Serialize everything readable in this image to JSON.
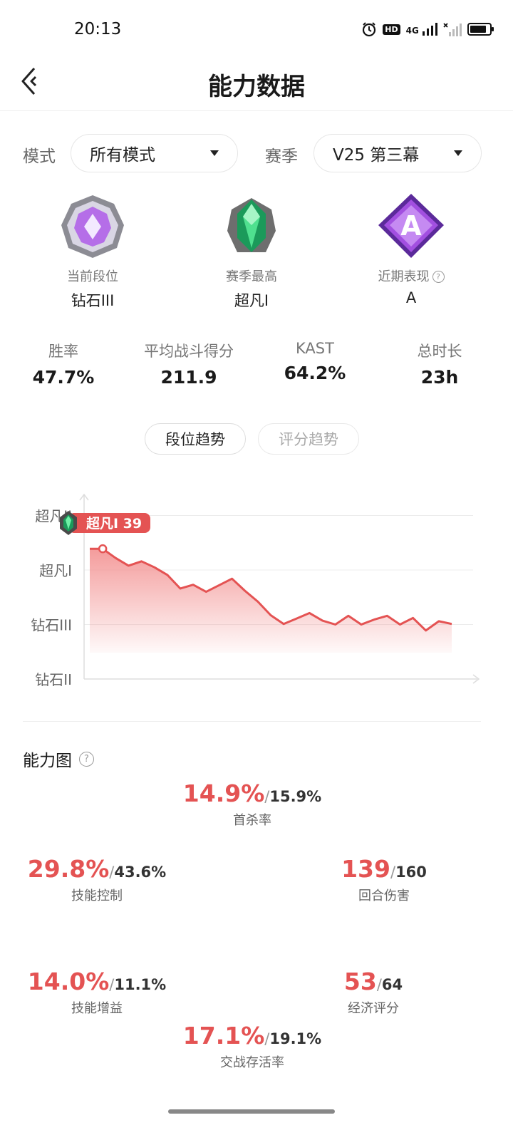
{
  "status_bar": {
    "time": "20:13",
    "icons": [
      "alarm-icon",
      "hd-icon",
      "signal-4g-icon",
      "signal-icon",
      "battery-icon"
    ],
    "hd_label": "HD",
    "net_label": "4G"
  },
  "header": {
    "title": "能力数据",
    "back_icon": "back-arrow-icon"
  },
  "filters": {
    "mode_label": "模式",
    "mode_value": "所有模式",
    "season_label": "赛季",
    "season_value": "V25 第三幕"
  },
  "ranks": [
    {
      "label": "当前段位",
      "value": "钻石III",
      "icon": "diamond-rank-icon",
      "has_help": false
    },
    {
      "label": "赛季最高",
      "value": "超凡I",
      "icon": "ascendant-rank-icon",
      "has_help": false
    },
    {
      "label": "近期表现",
      "value": "A",
      "icon": "performance-a-icon",
      "has_help": true
    }
  ],
  "stats": [
    {
      "label": "胜率",
      "value": "47.7%"
    },
    {
      "label": "平均战斗得分",
      "value": "211.9"
    },
    {
      "label": "KAST",
      "value": "64.2%"
    },
    {
      "label": "总时长",
      "value": "23h"
    }
  ],
  "tabs": [
    {
      "label": "段位趋势",
      "active": true
    },
    {
      "label": "评分趋势",
      "active": false
    }
  ],
  "chart_data": {
    "type": "area",
    "title": "",
    "xlabel": "",
    "ylabel": "",
    "y_tick_labels": [
      "钻石II",
      "钻石III",
      "超凡I",
      "超凡II"
    ],
    "y_tick_values": [
      0,
      1,
      2,
      3
    ],
    "ylim": [
      0,
      3.3
    ],
    "x": [
      1,
      2,
      3,
      4,
      5,
      6,
      7,
      8,
      9,
      10,
      11,
      12,
      13,
      14,
      15,
      16,
      17,
      18,
      19,
      20,
      21,
      22,
      23,
      24,
      25,
      26,
      27,
      28
    ],
    "values": [
      2.39,
      2.39,
      2.22,
      2.08,
      2.16,
      2.05,
      1.91,
      1.66,
      1.73,
      1.6,
      1.72,
      1.84,
      1.62,
      1.42,
      1.17,
      1.01,
      1.11,
      1.21,
      1.07,
      1.0,
      1.16,
      1.0,
      1.09,
      1.16,
      1.0,
      1.12,
      0.89,
      1.06,
      1.01
    ],
    "current_marker": {
      "label": "超凡I 39",
      "index": 1
    },
    "line_color": "#e45353",
    "fill_color": "#f28a8a",
    "grid": true
  },
  "ability": {
    "title": "能力图",
    "metrics": [
      {
        "label": "首杀率",
        "value": "14.9%",
        "ref": "15.9%"
      },
      {
        "label": "技能控制",
        "value": "29.8%",
        "ref": "43.6%"
      },
      {
        "label": "回合伤害",
        "value": "139",
        "ref": "160"
      },
      {
        "label": "技能增益",
        "value": "14.0%",
        "ref": "11.1%"
      },
      {
        "label": "经济评分",
        "value": "53",
        "ref": "64"
      },
      {
        "label": "交战存活率",
        "value": "17.1%",
        "ref": "19.1%"
      }
    ],
    "slash": "/"
  },
  "colors": {
    "accent_red": "#e45353",
    "text_dark": "#1a1a1a",
    "text_gray": "#777777"
  }
}
